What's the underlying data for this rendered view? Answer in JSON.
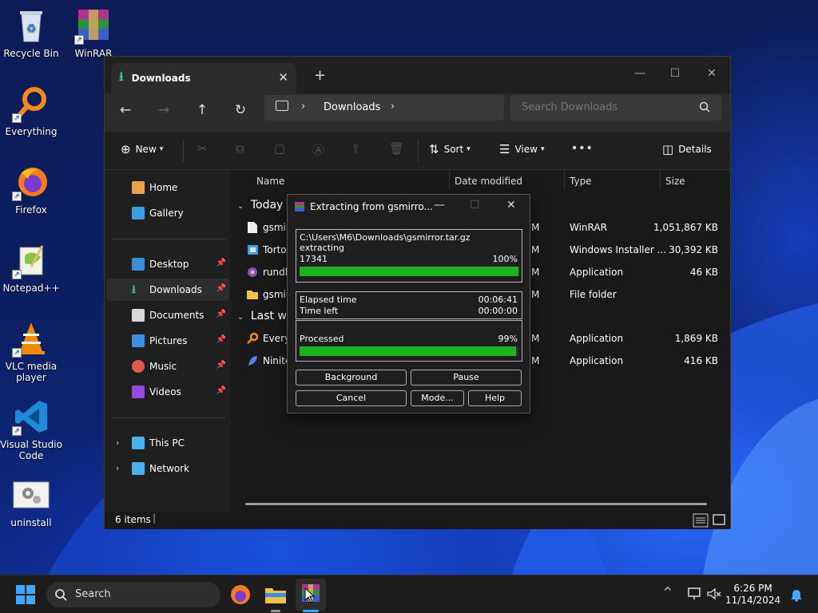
{
  "desktop": {
    "icons": [
      {
        "label": "Recycle Bin",
        "icon": "recycle-bin-icon"
      },
      {
        "label": "WinRAR",
        "icon": "winrar-icon"
      },
      {
        "label": "Everything",
        "icon": "everything-icon"
      },
      {
        "label": "Firefox",
        "icon": "firefox-icon"
      },
      {
        "label": "Notepad++",
        "icon": "notepadpp-icon"
      },
      {
        "label": "VLC media player",
        "icon": "vlc-icon"
      },
      {
        "label": "Visual Studio Code",
        "icon": "vscode-icon"
      },
      {
        "label": "uninstall",
        "icon": "uninstall-icon"
      }
    ]
  },
  "explorer": {
    "tab_title": "Downloads",
    "address_crumb": "Downloads",
    "search_placeholder": "Search Downloads",
    "toolbar": {
      "new_label": "New",
      "sort_label": "Sort",
      "view_label": "View",
      "more_label": "•••",
      "details_label": "Details"
    },
    "sidebar": {
      "items": [
        {
          "label": "Home"
        },
        {
          "label": "Gallery"
        },
        {
          "label": "Desktop"
        },
        {
          "label": "Downloads"
        },
        {
          "label": "Documents"
        },
        {
          "label": "Pictures"
        },
        {
          "label": "Music"
        },
        {
          "label": "Videos"
        },
        {
          "label": "This PC"
        },
        {
          "label": "Network"
        }
      ]
    },
    "columns": {
      "name": "Name",
      "date": "Date modified",
      "type": "Type",
      "size": "Size"
    },
    "groups": {
      "today": "Today",
      "last_week": "Last we"
    },
    "files": [
      {
        "name": "gsmir",
        "date": "M",
        "type": "WinRAR",
        "size": "1,051,867 KB"
      },
      {
        "name": "Tortoi",
        "date": "M",
        "type": "Windows Installer ...",
        "size": "30,392 KB"
      },
      {
        "name": "rundll",
        "date": "M",
        "type": "Application",
        "size": "46 KB"
      },
      {
        "name": "gsmir",
        "date": "M",
        "type": "File folder",
        "size": ""
      },
      {
        "name": "Everyt",
        "date": "M",
        "type": "Application",
        "size": "1,869 KB"
      },
      {
        "name": "Ninite",
        "date": "M",
        "type": "Application",
        "size": "416 KB"
      }
    ],
    "status": "6 items"
  },
  "rar": {
    "title": "Extracting from gsmirro...",
    "path": "C:\\Users\\M6\\Downloads\\gsmirror.tar.gz",
    "action": "extracting",
    "file_count": "17341",
    "file_percent_label": "100%",
    "file_progress": 1.0,
    "elapsed_label": "Elapsed time",
    "elapsed_value": "00:06:41",
    "left_label": "Time left",
    "left_value": "00:00:00",
    "processed_label": "Processed",
    "processed_percent_label": "99%",
    "processed_progress": 0.99,
    "buttons": {
      "background": "Background",
      "pause": "Pause",
      "cancel": "Cancel",
      "mode": "Mode...",
      "help": "Help"
    }
  },
  "taskbar": {
    "search_label": "Search",
    "time": "6:26 PM",
    "date": "11/14/2024"
  },
  "colors": {
    "progress_green": "#1eb31e",
    "accent_blue": "#3fa7ff"
  }
}
